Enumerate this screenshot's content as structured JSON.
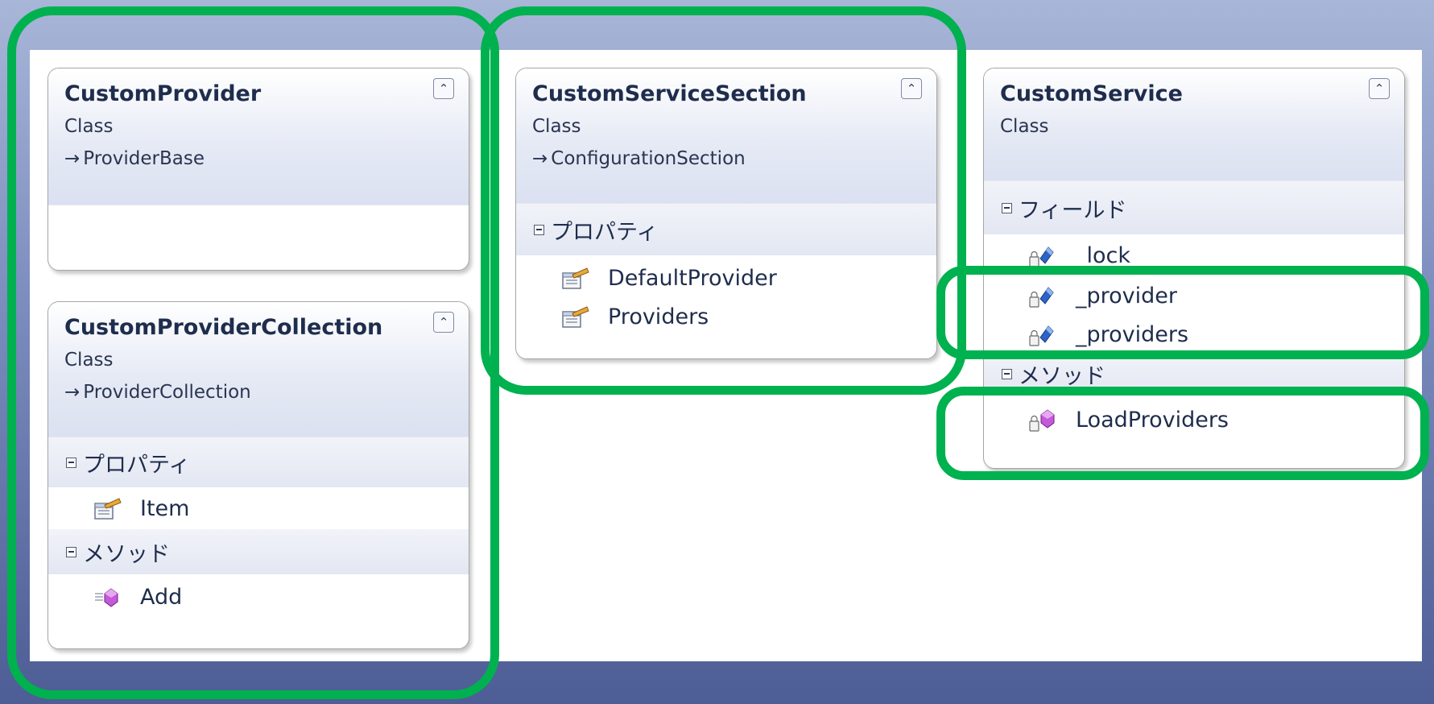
{
  "classes": {
    "custom_provider": {
      "name": "CustomProvider",
      "kind": "Class",
      "base": "ProviderBase"
    },
    "custom_provider_collection": {
      "name": "CustomProviderCollection",
      "kind": "Class",
      "base": "ProviderCollection",
      "sections": [
        {
          "title": "プロパティ",
          "members": [
            "Item"
          ]
        },
        {
          "title": "メソッド",
          "members": [
            "Add"
          ]
        }
      ]
    },
    "custom_service_section": {
      "name": "CustomServiceSection",
      "kind": "Class",
      "base": "ConfigurationSection",
      "sections": [
        {
          "title": "プロパティ",
          "members": [
            "DefaultProvider",
            "Providers"
          ]
        }
      ]
    },
    "custom_service": {
      "name": "CustomService",
      "kind": "Class",
      "sections": [
        {
          "title": "フィールド",
          "members": [
            "_lock",
            "_provider",
            "_providers"
          ]
        },
        {
          "title": "メソッド",
          "members": [
            "LoadProviders"
          ]
        }
      ]
    }
  },
  "glyphs": {
    "inherit_arrow": "→",
    "collapse": "⌃"
  },
  "colors": {
    "highlight": "#00b14f",
    "background": "#7e8fc0"
  },
  "icons": {
    "property": "property-icon",
    "field": "private-field-icon",
    "private_method": "private-method-icon",
    "public_method": "method-icon"
  }
}
